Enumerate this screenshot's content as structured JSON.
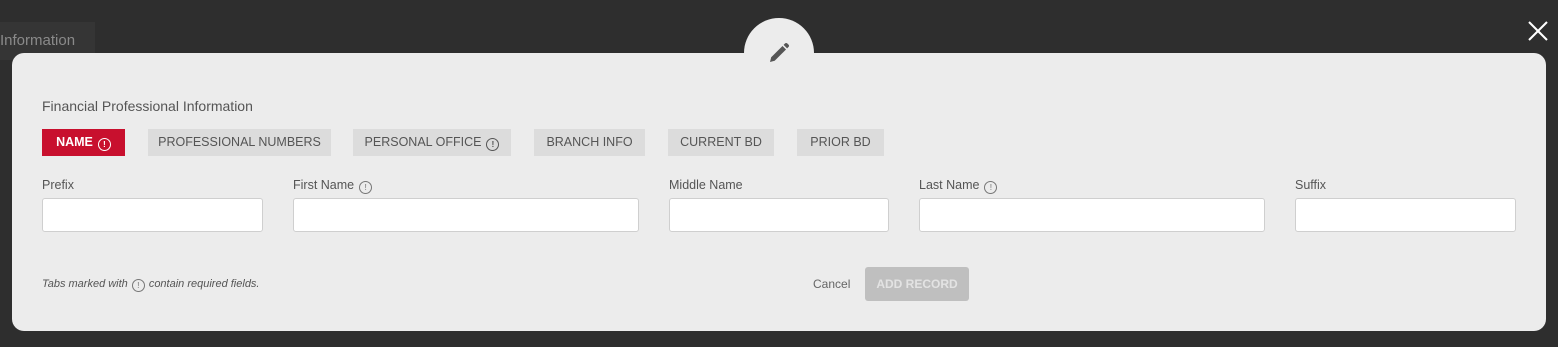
{
  "background": {
    "tab_label": "Information"
  },
  "modal": {
    "title": "Financial Professional Information",
    "tabs": [
      {
        "label": "NAME",
        "required": true,
        "active": true
      },
      {
        "label": "PROFESSIONAL NUMBERS",
        "required": false,
        "active": false
      },
      {
        "label": "PERSONAL OFFICE",
        "required": true,
        "active": false
      },
      {
        "label": "BRANCH INFO",
        "required": false,
        "active": false
      },
      {
        "label": "CURRENT BD",
        "required": false,
        "active": false
      },
      {
        "label": "PRIOR BD",
        "required": false,
        "active": false
      }
    ],
    "fields": [
      {
        "label": "Prefix",
        "required": false,
        "value": ""
      },
      {
        "label": "First Name",
        "required": true,
        "value": ""
      },
      {
        "label": "Middle Name",
        "required": false,
        "value": ""
      },
      {
        "label": "Last Name",
        "required": true,
        "value": ""
      },
      {
        "label": "Suffix",
        "required": false,
        "value": ""
      }
    ],
    "footnote_prefix": "Tabs marked with",
    "footnote_suffix": "contain required fields.",
    "cancel_label": "Cancel",
    "submit_label": "ADD RECORD",
    "info_glyph": "!"
  },
  "colors": {
    "accent": "#c8102e",
    "overlay": "#2e2e2e",
    "modal_bg": "#ececec"
  },
  "icons": {
    "edit": "pencil-icon",
    "close": "close-icon",
    "required": "info-circle-icon"
  }
}
